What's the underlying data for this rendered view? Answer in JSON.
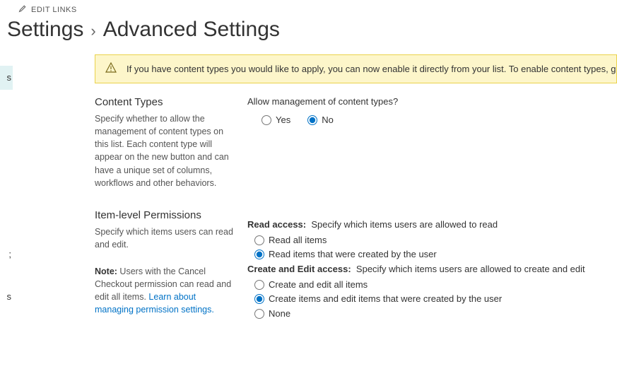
{
  "edit_links_label": "EDIT LINKS",
  "breadcrumb": {
    "parent": "Settings",
    "current": "Advanced Settings"
  },
  "sidebar": {
    "item_selected": "s",
    "item_2": ";",
    "item_3": "s"
  },
  "banner": {
    "text": "If you have content types you would like to apply, you can now enable it directly from your list. To enable content types, go"
  },
  "content_types": {
    "heading": "Content Types",
    "desc": "Specify whether to allow the management of content types on this list. Each content type will appear on the new button and can have a unique set of columns, workflows and other behaviors.",
    "question": "Allow management of content types?",
    "yes": "Yes",
    "no": "No",
    "selected": "no"
  },
  "item_permissions": {
    "heading": "Item-level Permissions",
    "desc": "Specify which items users can read and edit.",
    "note_label": "Note:",
    "note_text": " Users with the Cancel Checkout permission can read and edit all items. ",
    "note_link": "Learn about managing permission settings.",
    "read_label": "Read access:",
    "read_desc": "Specify which items users are allowed to read",
    "read_opt1": "Read all items",
    "read_opt2": "Read items that were created by the user",
    "read_selected": "opt2",
    "edit_label": "Create and Edit access:",
    "edit_desc": "Specify which items users are allowed to create and edit",
    "edit_opt1": "Create and edit all items",
    "edit_opt2": "Create items and edit items that were created by the user",
    "edit_opt3": "None",
    "edit_selected": "opt2"
  }
}
